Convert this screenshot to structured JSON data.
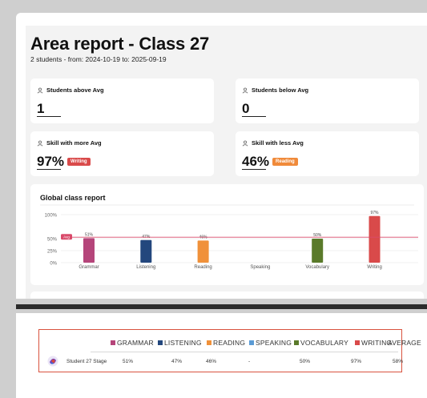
{
  "report": {
    "title": "Area report - Class 27",
    "subtitle": "2 students - from: 2024-10-19 to: 2025-09-19"
  },
  "kpis": [
    {
      "label": "Students above Avg",
      "value": "1",
      "badge": null
    },
    {
      "label": "Students below Avg",
      "value": "0",
      "badge": null
    },
    {
      "label": "Skill with more Avg",
      "value": "97%",
      "badge": "Writing",
      "badge_color": "#d94a4a"
    },
    {
      "label": "Skill with less Avg",
      "value": "46%",
      "badge": "Reading",
      "badge_color": "#f08a3a"
    }
  ],
  "chart_data": {
    "type": "bar",
    "title": "Global class report",
    "categories": [
      "Grammar",
      "Listening",
      "Reading",
      "Speaking",
      "Vocabulary",
      "Writing"
    ],
    "values": [
      51,
      47,
      46,
      null,
      50,
      97
    ],
    "value_labels": [
      "51%",
      "47%",
      "46%",
      "",
      "50%",
      "97%"
    ],
    "colors": [
      "#b5457a",
      "#23477d",
      "#f0913a",
      "#5b9bd5",
      "#5a7a2a",
      "#d94a4a"
    ],
    "y_ticks": [
      "100%",
      "50%",
      "25%",
      "0%"
    ],
    "avg_label": "Avg",
    "avg_value": 53,
    "avg_color": "#d94a6a",
    "ylim": [
      0,
      100
    ]
  },
  "table": {
    "legend": [
      {
        "label": "GRAMMAR",
        "color": "#b5457a"
      },
      {
        "label": "LISTENING",
        "color": "#23477d"
      },
      {
        "label": "READING",
        "color": "#f0913a"
      },
      {
        "label": "SPEAKING",
        "color": "#5b9bd5"
      },
      {
        "label": "VOCABULARY",
        "color": "#5a7a2a"
      },
      {
        "label": "WRITING",
        "color": "#d94a4a"
      },
      {
        "label": "AVERAGE",
        "color": null
      }
    ],
    "rows": [
      {
        "student": "Student 27 Stage",
        "values": [
          "51%",
          "47%",
          "46%",
          "-",
          "50%",
          "97%",
          "58%"
        ]
      }
    ]
  }
}
